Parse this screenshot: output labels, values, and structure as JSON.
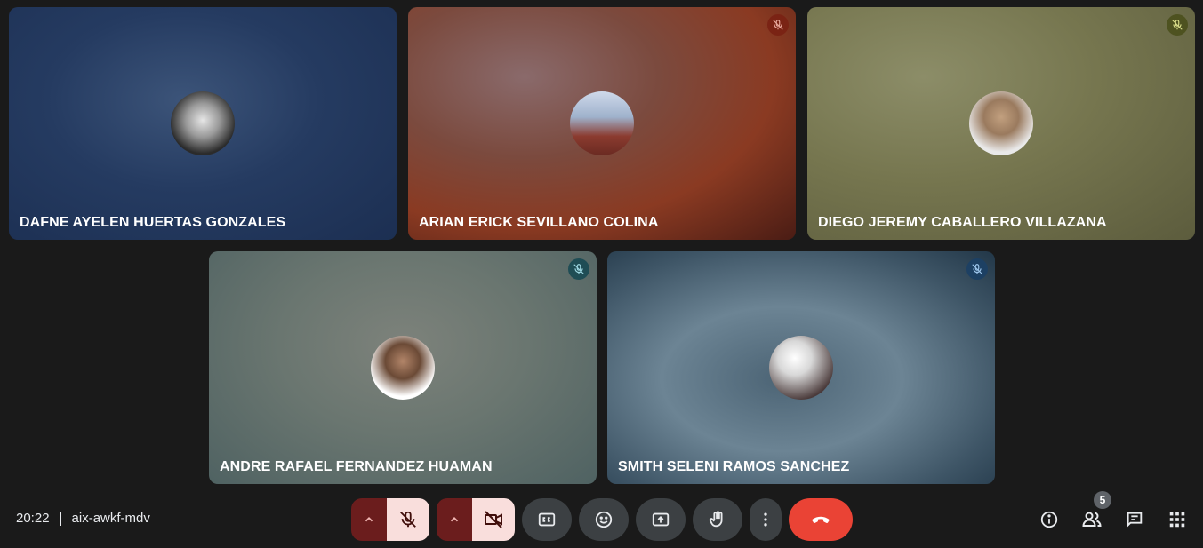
{
  "participants": [
    {
      "name": "DAFNE AYELEN HUERTAS GONZALES",
      "muted_badge": false
    },
    {
      "name": "ARIAN ERICK SEVILLANO COLINA",
      "muted_badge": true,
      "badge_color": "#7a2314"
    },
    {
      "name": "DIEGO JEREMY CABALLERO VILLAZANA",
      "muted_badge": true,
      "badge_color": "#4e5220"
    },
    {
      "name": "ANDRE RAFAEL FERNANDEZ HUAMAN",
      "muted_badge": true,
      "badge_color": "#1f4d55"
    },
    {
      "name": "SMITH SELENI RAMOS SANCHEZ",
      "muted_badge": true,
      "badge_color": "#1d4063"
    }
  ],
  "meeting": {
    "time": "20:22",
    "code": "aix-awkf-mdv"
  },
  "controls": {
    "people_count": "5",
    "accent_end_call": "#ea4335",
    "accent_off": "#f9dedc"
  },
  "icons": {
    "mic_off": "mic-off-icon",
    "camera_off": "camera-off-icon",
    "captions": "captions-icon",
    "emoji": "emoji-icon",
    "present": "present-screen-icon",
    "raise_hand": "raise-hand-icon",
    "more": "more-vertical-icon",
    "end_call": "end-call-icon",
    "info": "info-icon",
    "people": "people-icon",
    "chat": "chat-icon",
    "activities": "apps-grid-icon"
  }
}
